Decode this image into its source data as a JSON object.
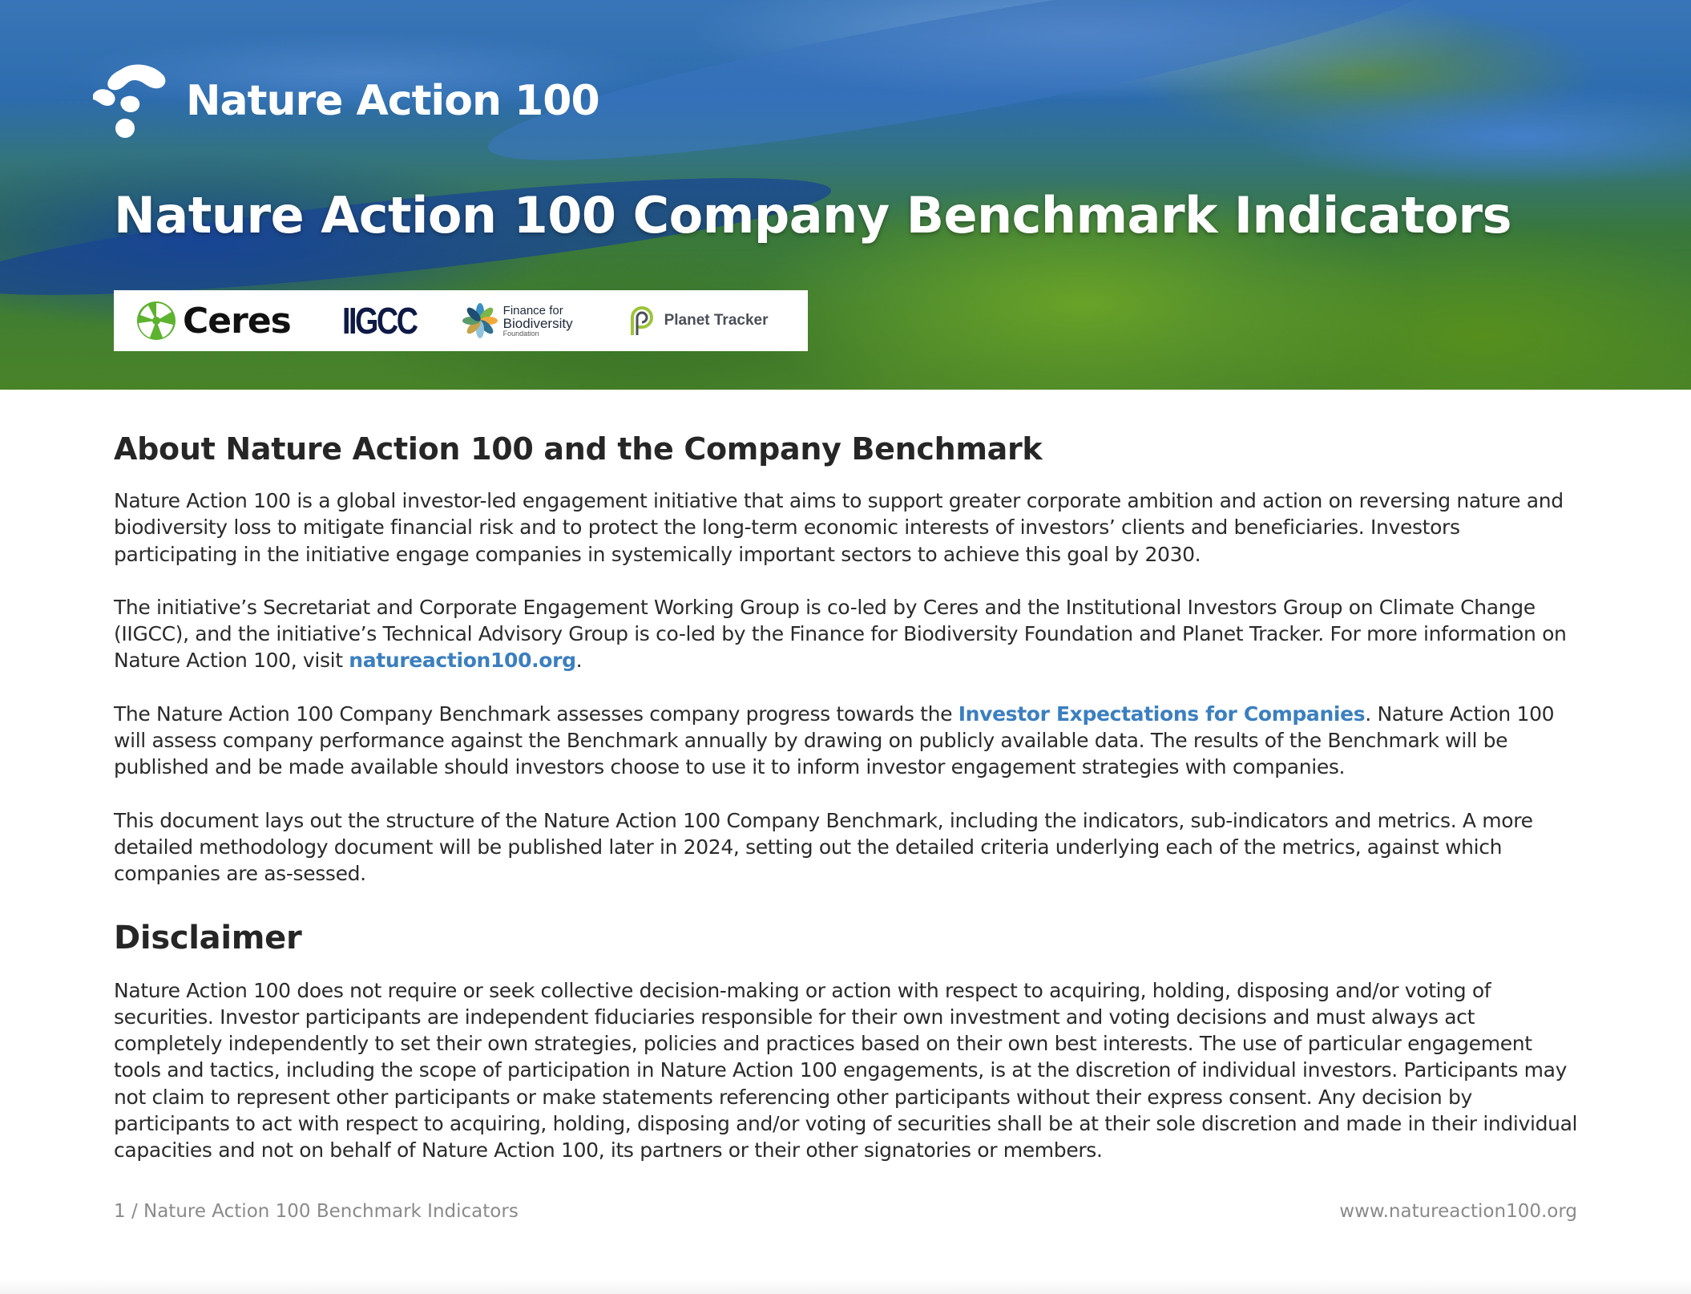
{
  "header": {
    "brand_name": "Nature Action 100",
    "title": "Nature Action 100 Company Benchmark Indicators",
    "partners": {
      "ceres": "Ceres",
      "iigcc": "IIGCC",
      "ffb_line1": "Finance for",
      "ffb_line2": "Biodiversity",
      "ffb_line3": "Foundation",
      "planet_tracker": "Planet Tracker"
    }
  },
  "about": {
    "heading": "About Nature Action 100 and the Company Benchmark",
    "p1": "Nature Action 100 is a global investor-led engagement initiative that aims to support greater corporate ambition and action on reversing nature and biodiversity loss to mitigate financial risk and to protect the long-term economic interests of investors’ clients and beneficiaries. Investors participating in the initiative engage companies in systemically important sectors to achieve this goal by 2030.",
    "p2_before": "The initiative’s Secretariat and Corporate Engagement Working Group is co-led by Ceres and the Institutional Investors Group on Climate Change (IIGCC), and the initiative’s Technical Advisory Group is co-led by the Finance for Biodiversity Foundation and Planet Tracker. For more information on Nature Action 100, visit ",
    "p2_link": "natureaction100.org",
    "p2_after": ".",
    "p3_before": "The Nature Action 100 Company Benchmark assesses company progress towards the ",
    "p3_link": "Investor Expectations for Companies",
    "p3_after": ". Nature Action 100 will assess company performance against the Benchmark annually by drawing on publicly available data. The results of the Benchmark will be published and be made available should investors choose to use it to inform investor engagement strategies with companies.",
    "p4": "This document lays out the structure of the Nature Action 100 Company Benchmark, including the indicators, sub-indicators and metrics. A more detailed methodology document will be published later in 2024, setting out the detailed criteria underlying each of the metrics, against which companies are as-sessed."
  },
  "disclaimer": {
    "heading": "Disclaimer",
    "text": "Nature Action 100 does not require or seek collective decision-making or action with respect to acquiring, holding, disposing and/or voting of securities. Investor participants are independent fiduciaries responsible for their own investment and voting decisions and must always act completely independently to set their own strategies, policies and practices based on their own best interests. The use of particular engagement tools and tactics, including the scope of participation in Nature Action 100 engagements, is at the discretion of individual investors. Participants may not claim to represent other participants or make statements referencing other participants without their express consent. Any decision by participants to act with respect to acquiring, holding, disposing and/or voting of securities shall be at their sole discretion and made in their individual capacities and not on behalf of Nature Action 100, its partners or their other signatories or members."
  },
  "footer": {
    "page_label": "1 / Nature Action 100 Benchmark Indicators",
    "website": "www.natureaction100.org"
  },
  "colors": {
    "link": "#3b7fc0",
    "ceres_green": "#5db22e",
    "iigcc_navy": "#0e1a45"
  }
}
